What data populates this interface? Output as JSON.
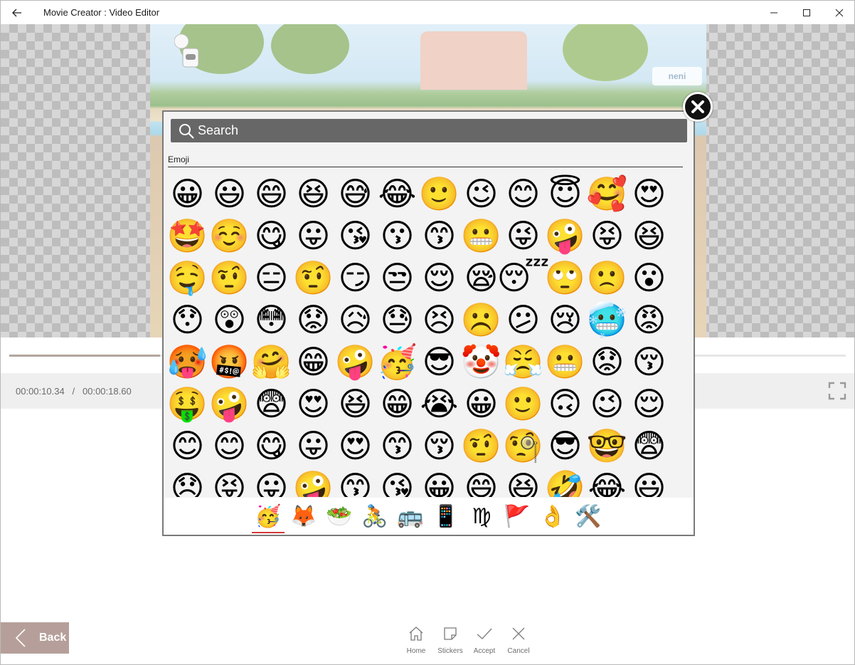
{
  "window": {
    "title": "Movie Creator : Video Editor"
  },
  "preview": {
    "logo_text": "neni"
  },
  "playback": {
    "current_time": "00:00:10.34",
    "separator": "/",
    "total_time": "00:00:18.60",
    "progress": 0.18
  },
  "picker": {
    "search_placeholder": "Search",
    "section_label": "Emoji",
    "emojis": [
      "😀",
      "😃",
      "😄",
      "😆",
      "😅",
      "😂",
      "🙂",
      "😉",
      "😊",
      "😇",
      "🥰",
      "😍",
      "🤩",
      "☺️",
      "😋",
      "😛",
      "😘",
      "😗",
      "😙",
      "😬",
      "😜",
      "🤪",
      "😝",
      "😆",
      "🤤",
      "🤨",
      "😑",
      "🤨",
      "😏",
      "😒",
      "😌",
      "😪",
      "😴",
      "🙄",
      "🙁",
      "😮",
      "😯",
      "😲",
      "😳",
      "😟",
      "😥",
      "😓",
      "😣",
      "☹️",
      "😕",
      "😢",
      "🥶",
      "😡",
      "🥵",
      "🤬",
      "🤗",
      "😁",
      "🤪",
      "🥳",
      "😎",
      "🤡",
      "😤",
      "😬",
      "😟",
      "😚",
      "🤑",
      "🤪",
      "😨",
      "😍",
      "😆",
      "😁",
      "😭",
      "😀",
      "🙂",
      "🙃",
      "😉",
      "😌",
      "😊",
      "😊",
      "😋",
      "😛",
      "😍",
      "😙",
      "😚",
      "🤨",
      "🧐",
      "😎",
      "🤓",
      "😨",
      "😞",
      "😝",
      "😛",
      "🤪",
      "😙",
      "😘",
      "😀",
      "😄",
      "😆",
      "🤣",
      "😂",
      "😃"
    ],
    "categories": [
      {
        "name": "smileys",
        "glyph": "🥳",
        "active": true
      },
      {
        "name": "animals",
        "glyph": "🦊",
        "active": false
      },
      {
        "name": "food",
        "glyph": "🥗",
        "active": false
      },
      {
        "name": "activities",
        "glyph": "🚴",
        "active": false
      },
      {
        "name": "travel",
        "glyph": "🚌",
        "active": false
      },
      {
        "name": "objects",
        "glyph": "📱",
        "active": false
      },
      {
        "name": "symbols",
        "glyph": "♍",
        "active": false
      },
      {
        "name": "flags",
        "glyph": "🚩",
        "active": false
      },
      {
        "name": "people",
        "glyph": "👌",
        "active": false
      },
      {
        "name": "tools",
        "glyph": "🛠️",
        "active": false
      }
    ]
  },
  "toolbar": {
    "back_label": "Back",
    "home_label": "Home",
    "stickers_label": "Stickers",
    "accept_label": "Accept",
    "cancel_label": "Cancel"
  }
}
